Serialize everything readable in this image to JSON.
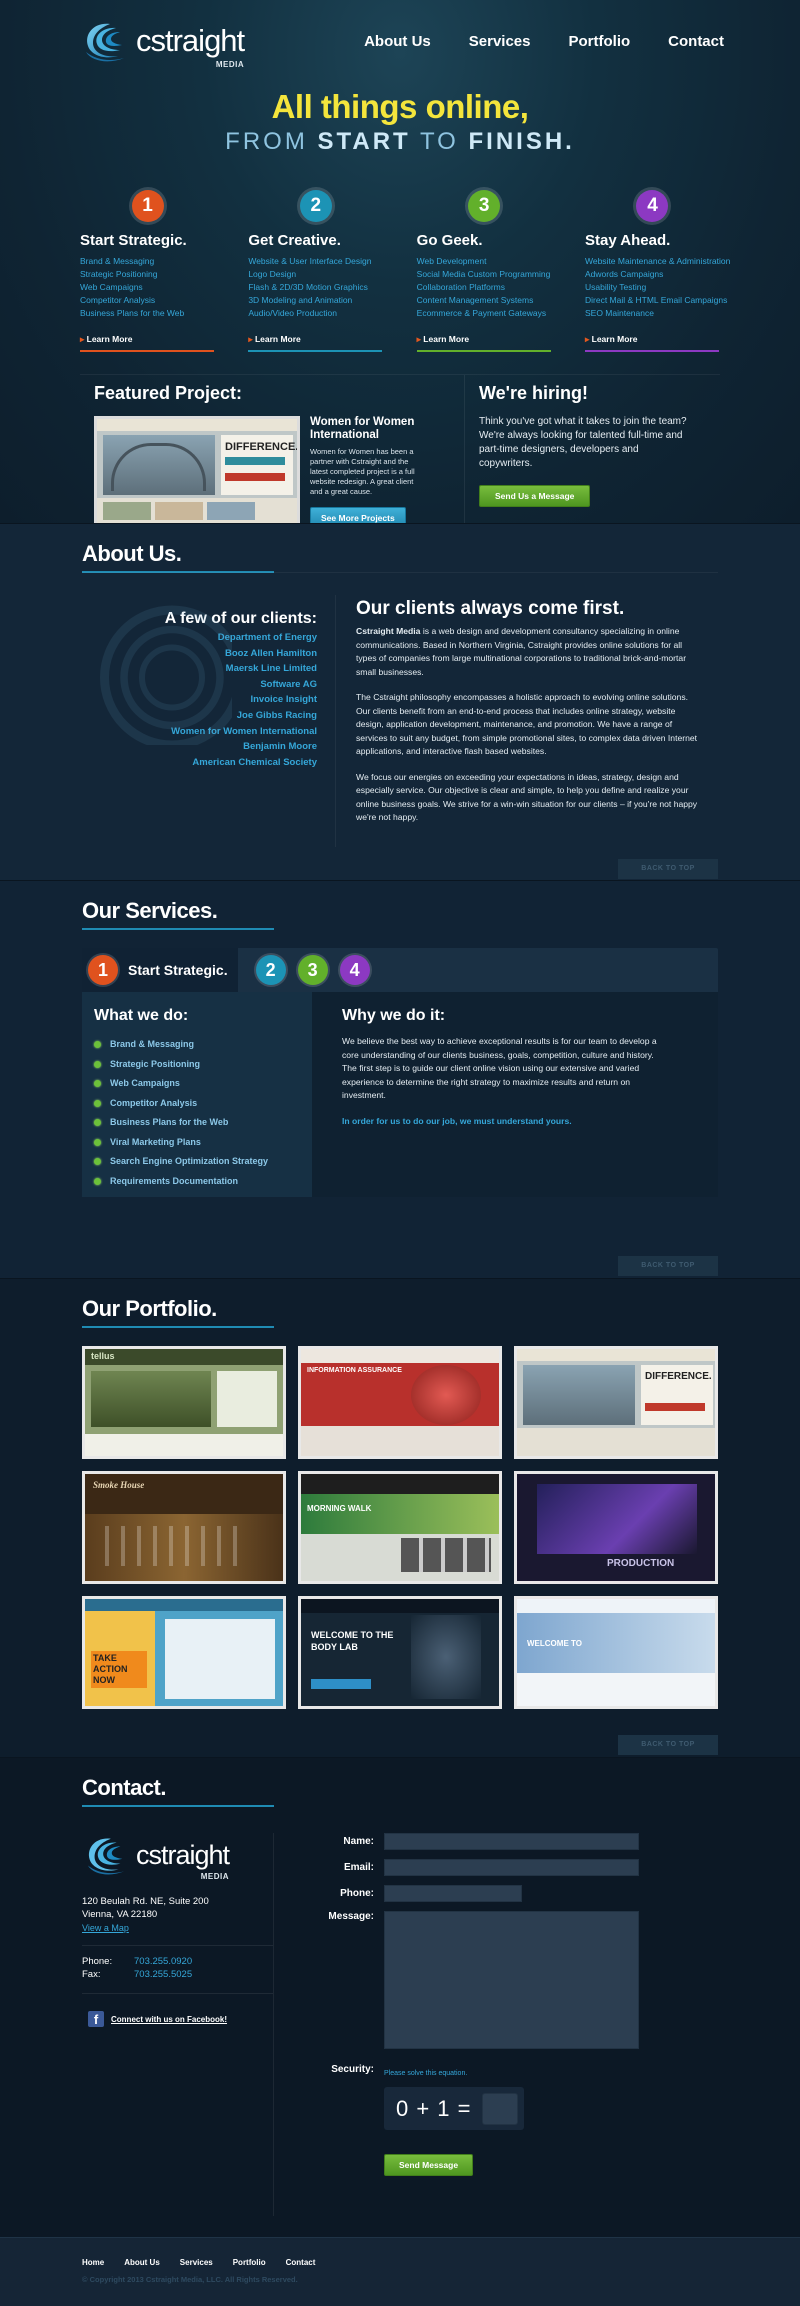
{
  "brand": {
    "name": "cstraight",
    "sub": "MEDIA"
  },
  "nav": [
    "About Us",
    "Services",
    "Portfolio",
    "Contact"
  ],
  "hero": {
    "line1": "All things online,",
    "line2_a": "FROM ",
    "line2_b": "START",
    "line2_c": " TO ",
    "line2_d": "FINISH."
  },
  "steps": [
    {
      "num": "1",
      "color": "#e0521e",
      "title": "Start Strategic.",
      "items": [
        "Brand & Messaging",
        "Strategic Positioning",
        "Web Campaigns",
        "Competitor Analysis",
        "Business Plans for the Web"
      ],
      "more": "Learn More"
    },
    {
      "num": "2",
      "color": "#1c93b5",
      "title": "Get Creative.",
      "items": [
        "Website & User Interface Design",
        "Logo Design",
        "Flash & 2D/3D Motion Graphics",
        "3D Modeling and Animation",
        "Audio/Video Production"
      ],
      "more": "Learn More"
    },
    {
      "num": "3",
      "color": "#62b02b",
      "title": "Go Geek.",
      "items": [
        "Web Development",
        "Social Media Custom Programming",
        "Collaboration Platforms",
        "Content Management Systems",
        "Ecommerce & Payment Gateways"
      ],
      "more": "Learn More"
    },
    {
      "num": "4",
      "color": "#8c39c2",
      "title": "Stay Ahead.",
      "items": [
        "Website Maintenance & Administration",
        "Adwords Campaigns",
        "Usability Testing",
        "Direct Mail & HTML Email Campaigns",
        "SEO Maintenance"
      ],
      "more": "Learn More"
    }
  ],
  "featured": {
    "heading": "Featured Project:",
    "name": "Women for Women International",
    "desc": "Women for Women has been a partner with Cstraight and the latest completed project is a full website redesign. A great client and a great cause.",
    "button": "See More Projects",
    "thumb_text": "DIFFERENCE."
  },
  "hiring": {
    "heading": "We're hiring!",
    "text": "Think you've got what it takes to join the team? We're always looking for talented full-time and part-time designers, developers and copywriters.",
    "button": "Send Us a Message"
  },
  "about": {
    "title": "About Us.",
    "clients_heading": "A few of our clients:",
    "clients": [
      "Department of Energy",
      "Booz Allen Hamilton",
      "Maersk Line Limited",
      "Software AG",
      "Invoice Insight",
      "Joe Gibbs Racing",
      "Women for Women International",
      "Benjamin Moore",
      "American Chemical Society"
    ],
    "heading": "Our clients always come first.",
    "p1_bold": "Cstraight Media",
    "p1": " is a web design and development consultancy specializing in online communications. Based in Northern Virginia, Cstraight provides online solutions for all types of companies from large multinational corporations to traditional brick-and-mortar small businesses.",
    "p2": "The Cstraight philosophy encompasses a holistic approach to evolving online solutions. Our clients benefit from an end-to-end process that includes online strategy, website design, application development, maintenance, and promotion. We have a range of services to suit any budget, from simple promotional sites, to complex data driven Internet applications, and interactive flash based websites.",
    "p3": "We focus our energies on exceeding your expectations in ideas, strategy, design and especially service. Our objective is clear and simple, to help you define and realize your online business goals. We strive for a win-win situation for our clients – if you're not happy we're not happy."
  },
  "back_to_top": "BACK TO TOP",
  "services": {
    "title": "Our Services.",
    "active_num": "1",
    "active_label": "Start Strategic.",
    "tabs": [
      {
        "num": "2",
        "color": "#1c93b5"
      },
      {
        "num": "3",
        "color": "#62b02b"
      },
      {
        "num": "4",
        "color": "#8c39c2"
      }
    ],
    "what_heading": "What we do:",
    "what_items": [
      "Brand & Messaging",
      "Strategic Positioning",
      "Web Campaigns",
      "Competitor Analysis",
      "Business Plans for the Web",
      "Viral Marketing Plans",
      "Search Engine Optimization Strategy",
      "Requirements Documentation"
    ],
    "why_heading": "Why we do it:",
    "why_text": "We believe the best way to achieve exceptional results is for our team to develop a core understanding of our clients business, goals, competition, culture and history. The first step is to guide our client online vision using our extensive and varied experience to determine the right strategy to maximize results and return on investment.",
    "why_highlight": "In order for us to do our job, we must understand yours."
  },
  "portfolio": {
    "title": "Our Portfolio.",
    "items": [
      {
        "label": "tellus",
        "bg": "#8fa173",
        "accent": "#3b4a2a"
      },
      {
        "label": "INFORMATION ASSURANCE",
        "bg": "#b8302c",
        "accent": "#e6e0d8"
      },
      {
        "label": "DIFFERENCE.",
        "bg": "#bfc7c7",
        "accent": "#c0392b"
      },
      {
        "label": "Smoke House",
        "bg": "#3b2815",
        "accent": "#b4874a"
      },
      {
        "label": "MORNING WALK",
        "bg": "#d8dbd4",
        "accent": "#2d7b3c"
      },
      {
        "label": "PRODUCTION",
        "bg": "#1a1830",
        "accent": "#6a3fb0"
      },
      {
        "label": "TAKE ACTION NOW",
        "bg": "#4fa3c8",
        "accent": "#f08a1c"
      },
      {
        "label": "WELCOME TO THE BODY LAB",
        "bg": "#162634",
        "accent": "#2e8fc7"
      },
      {
        "label": "WELCOME TO",
        "bg": "#a9c6e1",
        "accent": "#ffffff"
      }
    ]
  },
  "contact": {
    "title": "Contact.",
    "address1": "120 Beulah Rd. NE, Suite 200",
    "address2": "Vienna, VA 22180",
    "map_link": "View a Map",
    "phone_label": "Phone:",
    "phone": "703.255.0920",
    "fax_label": "Fax:",
    "fax": "703.255.5025",
    "facebook": "Connect with us on Facebook!",
    "form": {
      "name": "Name:",
      "email": "Email:",
      "phone": "Phone:",
      "message": "Message:",
      "security": "Security:",
      "security_note": "Please solve this equation.",
      "equation": "0 + 1 =",
      "submit": "Send Message"
    }
  },
  "footer": {
    "links": [
      "Home",
      "About Us",
      "Services",
      "Portfolio",
      "Contact"
    ],
    "copyright": "© Copyright 2013 Cstraight Media, LLC. All Rights Reserved."
  }
}
